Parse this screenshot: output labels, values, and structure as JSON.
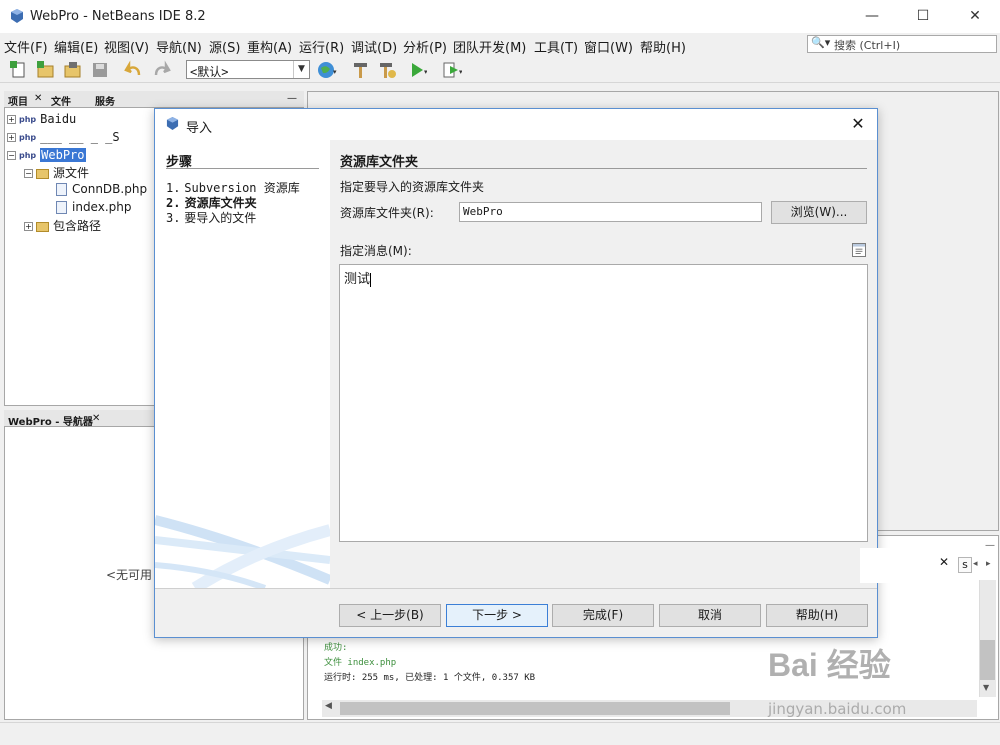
{
  "window": {
    "title": "WebPro - NetBeans IDE 8.2",
    "minimize": "—",
    "maximize": "☐",
    "close": "✕"
  },
  "menubar": {
    "items": [
      "文件(F)",
      "编辑(E)",
      "视图(V)",
      "导航(N)",
      "源(S)",
      "重构(A)",
      "运行(R)",
      "调试(D)",
      "分析(P)",
      "团队开发(M)",
      "工具(T)",
      "窗口(W)",
      "帮助(H)"
    ],
    "search_placeholder": "搜索 (Ctrl+I)"
  },
  "toolbar": {
    "config_value": "<默认>"
  },
  "project_panel": {
    "tabs": [
      "项目",
      "文件",
      "服务"
    ],
    "tree": [
      {
        "label": "Baidu"
      },
      {
        "label": "___ __ _ _S"
      },
      {
        "label": "WebPro"
      },
      {
        "label": "源文件"
      },
      {
        "label": "ConnDB.php"
      },
      {
        "label": "index.php"
      },
      {
        "label": "包含路径"
      }
    ]
  },
  "navigator_panel": {
    "tab": "WebPro - 导航器",
    "empty_text": "<无可用"
  },
  "output_panel": {
    "lines": [
      "成功:",
      "文件    index.php",
      "运行时: 255 ms, 已处理: 1 个文件, 0.357 KB"
    ],
    "tab_fragment": "s"
  },
  "dialog": {
    "title": "导入",
    "steps_title": "步骤",
    "steps": [
      {
        "num": "1.",
        "label": "Subversion 资源库",
        "active": false
      },
      {
        "num": "2.",
        "label": "资源库文件夹",
        "active": true
      },
      {
        "num": "3.",
        "label": "要导入的文件",
        "active": false
      }
    ],
    "content_title": "资源库文件夹",
    "instruction": "指定要导入的资源库文件夹",
    "folder_label": "资源库文件夹(R):",
    "folder_value": "WebPro",
    "browse_label": "浏览(W)...",
    "message_label": "指定消息(M):",
    "message_value": "测试",
    "buttons": {
      "back": "< 上一步(B)",
      "next": "下一步 >",
      "finish": "完成(F)",
      "cancel": "取消",
      "help": "帮助(H)"
    }
  },
  "watermark": {
    "logo": "Bai 经验",
    "url": "jingyan.baidu.com"
  }
}
